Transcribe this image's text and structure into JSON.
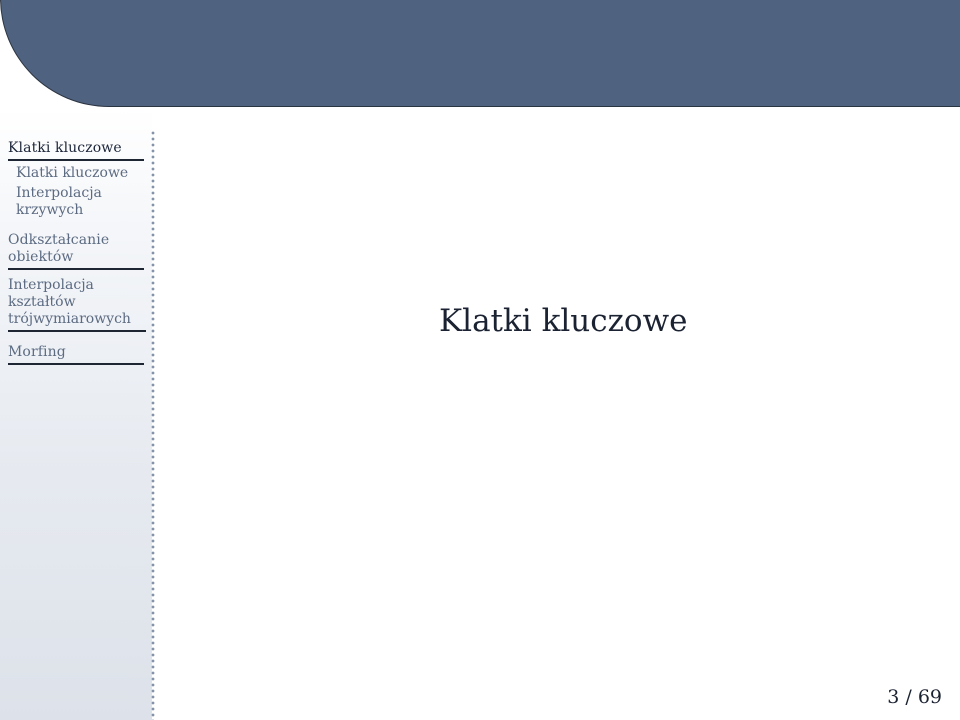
{
  "sidebar": {
    "sections": [
      {
        "label": "Klatki kluczowe",
        "active": true
      },
      {
        "label": "Odkształcanie obiektów",
        "active": false
      },
      {
        "label": "Interpolacja kształtów trójwymiarowych",
        "active": false
      },
      {
        "label": "Morfing",
        "active": false
      }
    ],
    "subsections": [
      {
        "label": "Klatki kluczowe"
      },
      {
        "label": "Interpolacja krzywych"
      }
    ]
  },
  "main": {
    "title": "Klatki kluczowe"
  },
  "footer": {
    "page_number": "3 / 69"
  },
  "colors": {
    "header": "#4f627f",
    "text_active": "#1b2438",
    "text_inactive": "#5c6b82"
  }
}
